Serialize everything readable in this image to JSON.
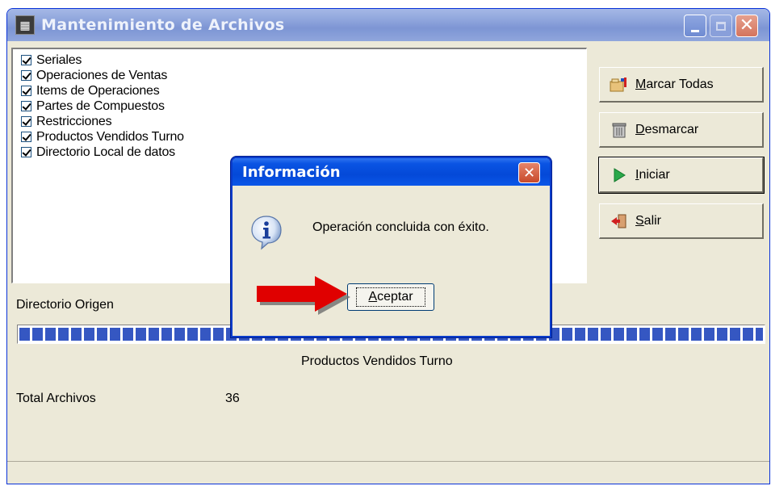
{
  "window": {
    "title": "Mantenimiento de Archivos"
  },
  "list": {
    "items": [
      {
        "label": "Seriales",
        "checked": true
      },
      {
        "label": "Operaciones de Ventas",
        "checked": true
      },
      {
        "label": "Items de Operaciones",
        "checked": true
      },
      {
        "label": "Partes de Compuestos",
        "checked": true
      },
      {
        "label": "Restricciones",
        "checked": true
      },
      {
        "label": "Productos Vendidos Turno",
        "checked": true
      },
      {
        "label": "Directorio Local de datos",
        "checked": true
      }
    ]
  },
  "buttons": {
    "marcar": "Marcar Todas",
    "desmarcar": "Desmarcar",
    "iniciar": "Iniciar",
    "salir": "Salir"
  },
  "labels": {
    "directorio_origen": "Directorio Origen",
    "current_item": "Productos Vendidos Turno",
    "total_archivos": "Total Archivos",
    "total_value": "36"
  },
  "progress": {
    "value": 1.0
  },
  "dialog": {
    "title": "Información",
    "message": "Operación concluida con éxito.",
    "ok_label": "Aceptar",
    "close_glyph": "✕"
  },
  "icons": {
    "app": "app-icon",
    "info": "info-icon",
    "annotation": "red-arrow"
  },
  "colors": {
    "accent": "#0a54e3",
    "progress": "#3557c2",
    "arrow": "#e00000"
  }
}
